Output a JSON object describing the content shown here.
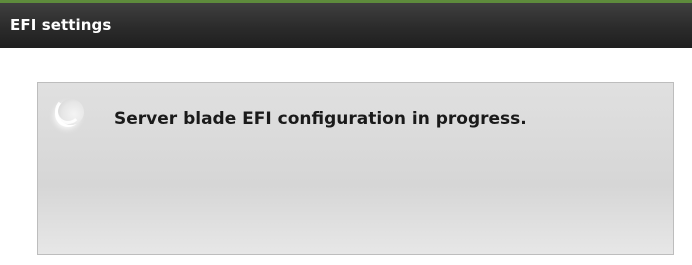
{
  "header": {
    "title": "EFI settings"
  },
  "status": {
    "message": "Server blade EFI configuration in progress.",
    "icon": "loading-spinner-icon"
  },
  "colors": {
    "header_background": "#2b2b2b",
    "header_accent": "#5e8b3c",
    "header_text": "#ffffff",
    "panel_background": "#d9d9d9",
    "panel_border": "#bdbdbd",
    "message_text": "#1a1a1a"
  }
}
